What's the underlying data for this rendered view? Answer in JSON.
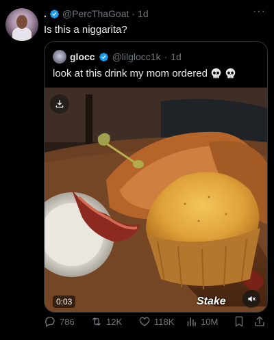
{
  "tweet": {
    "name_dot": ".",
    "handle": "@PercThaGoat",
    "separator": "·",
    "time": "1d",
    "more": "···",
    "text": "Is this a niggarita?"
  },
  "quote": {
    "name": "glocc",
    "handle": "@lilglocc1k",
    "separator": "·",
    "time": "1d",
    "text": "look at this drink my mom ordered",
    "emoji": [
      "skull-icon",
      "skull-icon"
    ],
    "video": {
      "duration": "0:03",
      "watermark": "Stake",
      "download_icon": "download-icon",
      "mute_icon": "volume-muted-icon"
    }
  },
  "actions": {
    "replies": "786",
    "reposts": "12K",
    "likes": "118K",
    "views": "10M"
  },
  "colors": {
    "background": "#000000",
    "text_primary": "#e7e9ea",
    "text_secondary": "#71767b",
    "verified": "#1d9bf0",
    "border": "#2f3336"
  }
}
